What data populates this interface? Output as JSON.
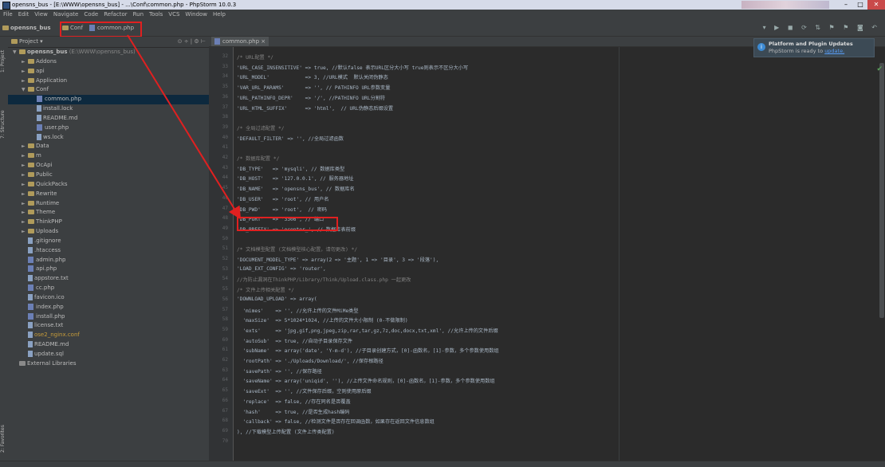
{
  "window": {
    "title": "opensns_bus - [E:\\WWW\\opensns_bus] - ...\\Conf\\common.php - PhpStorm 10.0.3"
  },
  "menu": [
    "File",
    "Edit",
    "View",
    "Navigate",
    "Code",
    "Refactor",
    "Run",
    "Tools",
    "VCS",
    "Window",
    "Help"
  ],
  "breadcrumb": {
    "project": "opensns_bus",
    "folder": "Conf",
    "file": "common.php"
  },
  "panel": {
    "title": "Project",
    "left_tabs": [
      "1: Project",
      "7: Structure",
      "2: Favorites"
    ]
  },
  "tree": [
    {
      "label": "opensns_bus",
      "extra": " (E:\\WWW\\opensns_bus)",
      "type": "folder",
      "indent": 0,
      "arrow": "▼",
      "bold": true
    },
    {
      "label": "Addons",
      "type": "folder",
      "indent": 1,
      "arrow": "►"
    },
    {
      "label": "api",
      "type": "folder",
      "indent": 1,
      "arrow": "►"
    },
    {
      "label": "Application",
      "type": "folder",
      "indent": 1,
      "arrow": "►"
    },
    {
      "label": "Conf",
      "type": "folder",
      "indent": 1,
      "arrow": "▼"
    },
    {
      "label": "common.php",
      "type": "php",
      "indent": 2,
      "selected": true
    },
    {
      "label": "install.lock",
      "type": "file",
      "indent": 2
    },
    {
      "label": "README.md",
      "type": "file",
      "indent": 2
    },
    {
      "label": "user.php",
      "type": "php",
      "indent": 2
    },
    {
      "label": "ws.lock",
      "type": "file",
      "indent": 2
    },
    {
      "label": "Data",
      "type": "folder",
      "indent": 1,
      "arrow": "►"
    },
    {
      "label": "m",
      "type": "folder",
      "indent": 1,
      "arrow": "►"
    },
    {
      "label": "OcApi",
      "type": "folder",
      "indent": 1,
      "arrow": "►"
    },
    {
      "label": "Public",
      "type": "folder",
      "indent": 1,
      "arrow": "►"
    },
    {
      "label": "QuickPacks",
      "type": "folder",
      "indent": 1,
      "arrow": "►"
    },
    {
      "label": "Rewrite",
      "type": "folder",
      "indent": 1,
      "arrow": "►"
    },
    {
      "label": "Runtime",
      "type": "folder",
      "indent": 1,
      "arrow": "►"
    },
    {
      "label": "Theme",
      "type": "folder",
      "indent": 1,
      "arrow": "►"
    },
    {
      "label": "ThinkPHP",
      "type": "folder",
      "indent": 1,
      "arrow": "►"
    },
    {
      "label": "Uploads",
      "type": "folder",
      "indent": 1,
      "arrow": "►"
    },
    {
      "label": ".gitignore",
      "type": "file",
      "indent": 1
    },
    {
      "label": ".htaccess",
      "type": "file",
      "indent": 1
    },
    {
      "label": "admin.php",
      "type": "php",
      "indent": 1
    },
    {
      "label": "api.php",
      "type": "php",
      "indent": 1
    },
    {
      "label": "appstore.txt",
      "type": "file",
      "indent": 1
    },
    {
      "label": "cc.php",
      "type": "php",
      "indent": 1
    },
    {
      "label": "favicon.ico",
      "type": "file",
      "indent": 1
    },
    {
      "label": "index.php",
      "type": "php",
      "indent": 1
    },
    {
      "label": "install.php",
      "type": "php",
      "indent": 1
    },
    {
      "label": "license.txt",
      "type": "file",
      "indent": 1
    },
    {
      "label": "ose2_nginx.conf",
      "type": "file",
      "indent": 1,
      "color": "#c79c3a"
    },
    {
      "label": "README.md",
      "type": "file",
      "indent": 1
    },
    {
      "label": "update.sql",
      "type": "file",
      "indent": 1
    },
    {
      "label": "External Libraries",
      "type": "lib",
      "indent": 0
    }
  ],
  "tab": {
    "label": "common.php"
  },
  "code_start_line": 32,
  "code": [
    "/* URL配置 */",
    "'URL_CASE_INSENSITIVE' => true, //默认false 表示URL区分大小写 true则表示不区分大小写",
    "'URL_MODEL'            => 3, //URL模式  默认关闭伪静态",
    "'VAR_URL_PARAMS'       => '', // PATHINFO URL参数变量",
    "'URL_PATHINFO_DEPR'    => '/', //PATHINFO URL分割符",
    "'URL_HTML_SUFFIX'      => 'html',  // URL伪静态后缀设置",
    "",
    "/* 全局过滤配置 */",
    "'DEFAULT_FILTER' => '', //全局过滤函数",
    "",
    "/* 数据库配置 */",
    "'DB_TYPE'   => 'mysqli', // 数据库类型",
    "'DB_HOST'   => '127.0.0.1', // 服务器地址",
    "'DB_NAME'   => 'opensns_bus', // 数据库名",
    "'DB_USER'   => 'root', // 用户名",
    "'DB_PWD'    => 'root',  // 密码",
    "'DB_PORT'   => '3306', // 端口",
    "'DB_PREFIX' => 'ocenter_', // 数据库表前缀",
    "",
    "/* 文档模型配置 (文档模型核心配置，请勿更改) */",
    "'DOCUMENT_MODEL_TYPE' => array(2 => '主题', 1 => '目录', 3 => '段落'),",
    "'LOAD_EXT_CONFIG' => 'router',",
    "//为防止漏洞在ThinkPHP/Library/Think/Upload.class.php 一起更改",
    "/* 文件上传相关配置 */",
    "'DOWNLOAD_UPLOAD' => array(",
    "  'mimes'    => '', //允许上传的文件MiMe类型",
    "  'maxSize'  => 5*1024*1024, //上传的文件大小限制 (0-不做限制)",
    "  'exts'     => 'jpg,gif,png,jpeg,zip,rar,tar,gz,7z,doc,docx,txt,xml', //允许上传的文件后缀",
    "  'autoSub'  => true, //自动子目录保存文件",
    "  'subName'  => array('date', 'Y-m-d'), //子目录创建方式，[0]-函数名，[1]-参数，多个参数使用数组",
    "  'rootPath' => './Uploads/Download/', //保存根路径",
    "  'savePath' => '', //保存路径",
    "  'saveName' => array('uniqid', ''), //上传文件命名规则，[0]-函数名，[1]-参数，多个参数使用数组",
    "  'saveExt'  => '', //文件保存后缀，空则使用原后缀",
    "  'replace'  => false, //存在同名是否覆盖",
    "  'hash'     => true, //是否生成hash编码",
    "  'callback' => false, //检测文件是否存在回调函数，如果存在返回文件信息数组",
    "), //下载模型上传配置 (文件上传类配置)",
    ""
  ],
  "notification": {
    "title": "Platform and Plugin Updates",
    "body_prefix": "PhpStorm is ready to ",
    "link": "update."
  },
  "colors": {
    "highlight_box": "#e02020",
    "keyword": "#cc7832",
    "string": "#6a8759",
    "selection": "#0d293e"
  }
}
